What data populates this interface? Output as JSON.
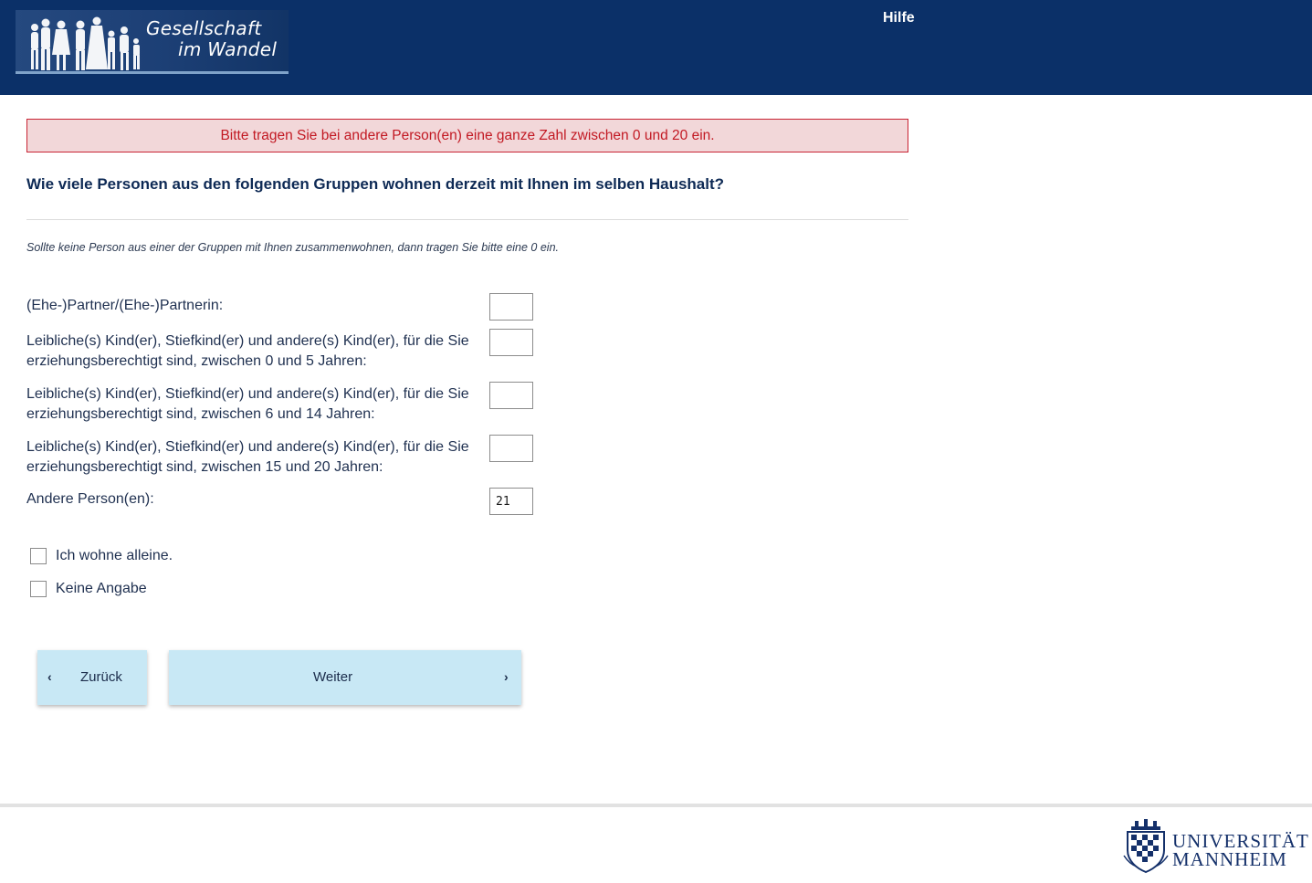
{
  "header": {
    "logo_line1": "Gesellschaft",
    "logo_line2": "im Wandel",
    "help_label": "Hilfe"
  },
  "error_message": "Bitte tragen Sie bei andere Person(en) eine ganze Zahl zwischen 0 und 20 ein.",
  "question": "Wie viele Personen aus den folgenden Gruppen wohnen derzeit mit Ihnen im selben Haushalt?",
  "instruction": "Sollte keine Person aus einer der Gruppen mit Ihnen zusammenwohnen, dann tragen Sie bitte eine 0 ein.",
  "rows": [
    {
      "label": "(Ehe-)Partner/(Ehe-)Partnerin:",
      "value": ""
    },
    {
      "label": "Leibliche(s) Kind(er), Stiefkind(er) und andere(s) Kind(er), für die Sie erziehungsberechtigt sind, zwischen 0 und 5 Jahren:",
      "value": ""
    },
    {
      "label": "Leibliche(s) Kind(er), Stiefkind(er) und andere(s) Kind(er), für die Sie erziehungsberechtigt sind, zwischen 6 und 14 Jahren:",
      "value": ""
    },
    {
      "label": "Leibliche(s) Kind(er), Stiefkind(er) und andere(s) Kind(er), für die Sie erziehungsberechtigt sind, zwischen 15 und 20 Jahren:",
      "value": ""
    },
    {
      "label": "Andere Person(en):",
      "value": "21"
    }
  ],
  "checkboxes": [
    {
      "label": "Ich wohne alleine.",
      "checked": false
    },
    {
      "label": "Keine Angabe",
      "checked": false
    }
  ],
  "nav": {
    "back_label": "Zurück",
    "next_label": "Weiter"
  },
  "footer": {
    "uni_line1": "UNIVERSITÄT",
    "uni_line2": "MANNHEIM"
  },
  "colors": {
    "header_bg": "#0b3068",
    "error_bg": "#f2d7d9",
    "error_text": "#c21923",
    "button_bg": "#c8e8f5"
  }
}
